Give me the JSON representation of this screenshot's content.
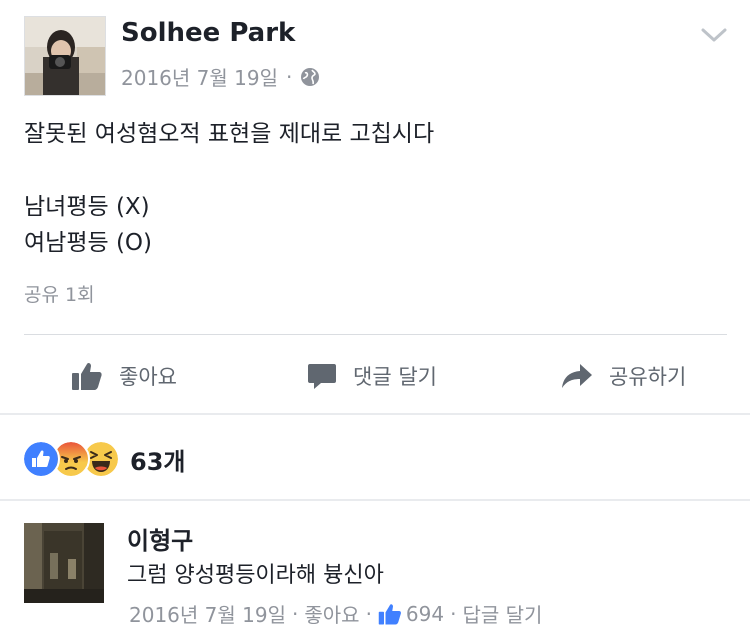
{
  "post": {
    "author": "Solhee Park",
    "date": "2016년 7월 19일",
    "meta_separator": "·",
    "privacy_icon": "globe-icon",
    "lines": [
      "잘못된 여성혐오적 표현을 제대로 고칩시다",
      "남녀평등 (X)",
      "여남평등 (O)"
    ],
    "shares": "공유 1회"
  },
  "actions": {
    "like": "좋아요",
    "comment": "댓글 달기",
    "share": "공유하기"
  },
  "reactions": {
    "icons": [
      "like-reaction-icon",
      "angry-reaction-icon",
      "haha-reaction-icon"
    ],
    "count": "63개"
  },
  "comment": {
    "author": "이형구",
    "text": "그럼 양성평등이라해 븅신아",
    "date": "2016년 7월 19일",
    "separator": "·",
    "like_label": "좋아요",
    "like_count": "694",
    "reply_label": "답글 달기"
  },
  "colors": {
    "text": "#1d2129",
    "meta": "#90949c",
    "action": "#606770",
    "like_blue": "#4080ff",
    "reaction_yellow": "#f7c94b"
  }
}
